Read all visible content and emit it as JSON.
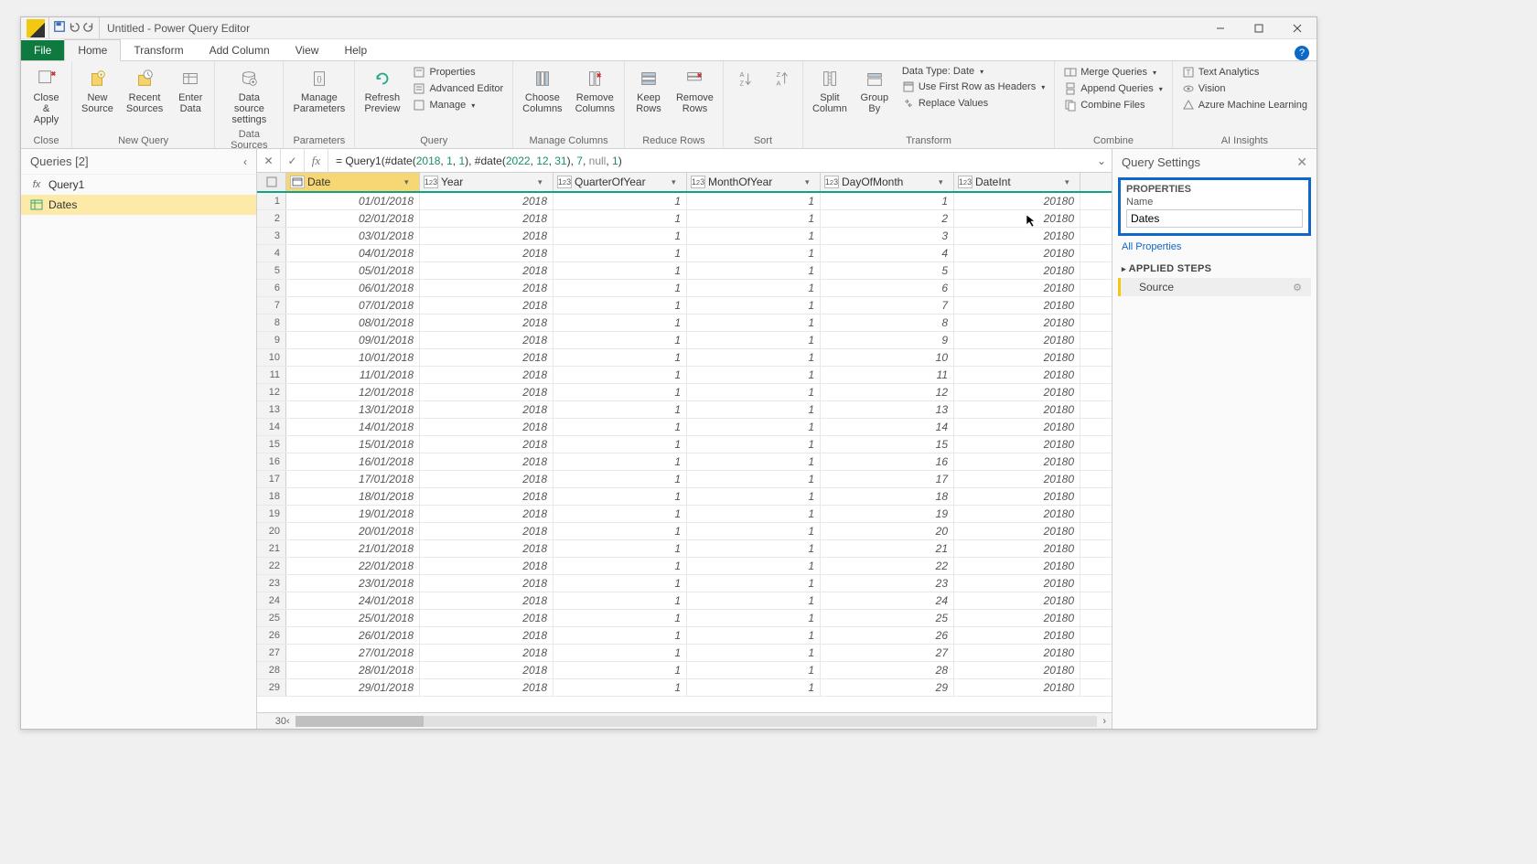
{
  "window": {
    "title": "Untitled - Power Query Editor"
  },
  "tabs": {
    "file": "File",
    "home": "Home",
    "transform": "Transform",
    "addcolumn": "Add Column",
    "view": "View",
    "help": "Help"
  },
  "ribbon": {
    "close": {
      "closeApply": "Close &\nApply",
      "group": "Close"
    },
    "newquery": {
      "newSource": "New\nSource",
      "recentSources": "Recent\nSources",
      "enterData": "Enter\nData",
      "group": "New Query"
    },
    "datasources": {
      "dsSettings": "Data source\nsettings",
      "group": "Data Sources"
    },
    "parameters": {
      "manage": "Manage\nParameters",
      "group": "Parameters"
    },
    "query": {
      "refresh": "Refresh\nPreview",
      "properties": "Properties",
      "advEditor": "Advanced Editor",
      "manage": "Manage",
      "group": "Query"
    },
    "managecols": {
      "choose": "Choose\nColumns",
      "remove": "Remove\nColumns",
      "group": "Manage Columns"
    },
    "reducerows": {
      "keep": "Keep\nRows",
      "removerows": "Remove\nRows",
      "group": "Reduce Rows"
    },
    "sort": {
      "group": "Sort"
    },
    "transform": {
      "split": "Split\nColumn",
      "groupby": "Group\nBy",
      "datatype": "Data Type: Date",
      "firstrow": "Use First Row as Headers",
      "replace": "Replace Values",
      "group": "Transform"
    },
    "combine": {
      "merge": "Merge Queries",
      "append": "Append Queries",
      "combinefiles": "Combine Files",
      "group": "Combine"
    },
    "ai": {
      "textan": "Text Analytics",
      "vision": "Vision",
      "aml": "Azure Machine Learning",
      "group": "AI Insights"
    }
  },
  "queriesPane": {
    "title": "Queries [2]",
    "items": [
      {
        "name": "Query1",
        "type": "fx"
      },
      {
        "name": "Dates",
        "type": "table",
        "selected": true
      }
    ]
  },
  "formula": {
    "prefix": "= Query1(#date(",
    "y1": "2018",
    "c1": ", ",
    "m1": "1",
    "c2": ", ",
    "d1": "1",
    "mid": "), #date(",
    "y2": "2022",
    "c3": ", ",
    "m2": "12",
    "c4": ", ",
    "d2": "31",
    "tail1": "), ",
    "step": "7",
    "tail2": ", ",
    "nul": "null",
    "tail3": ", ",
    "one": "1",
    "tail4": ")"
  },
  "columns": [
    {
      "key": "Date",
      "label": "Date",
      "type": "date",
      "selected": true,
      "width": "cw-date"
    },
    {
      "key": "Year",
      "label": "Year",
      "type": "123",
      "width": "cw-year"
    },
    {
      "key": "QuarterOfYear",
      "label": "QuarterOfYear",
      "type": "123",
      "width": "cw-q"
    },
    {
      "key": "MonthOfYear",
      "label": "MonthOfYear",
      "type": "123",
      "width": "cw-m"
    },
    {
      "key": "DayOfMonth",
      "label": "DayOfMonth",
      "type": "123",
      "width": "cw-d"
    },
    {
      "key": "DateInt",
      "label": "DateInt",
      "type": "123",
      "width": "cw-di"
    }
  ],
  "rows": [
    {
      "n": 1,
      "Date": "01/01/2018",
      "Year": "2018",
      "QuarterOfYear": "1",
      "MonthOfYear": "1",
      "DayOfMonth": "1",
      "DateInt": "20180"
    },
    {
      "n": 2,
      "Date": "02/01/2018",
      "Year": "2018",
      "QuarterOfYear": "1",
      "MonthOfYear": "1",
      "DayOfMonth": "2",
      "DateInt": "20180"
    },
    {
      "n": 3,
      "Date": "03/01/2018",
      "Year": "2018",
      "QuarterOfYear": "1",
      "MonthOfYear": "1",
      "DayOfMonth": "3",
      "DateInt": "20180"
    },
    {
      "n": 4,
      "Date": "04/01/2018",
      "Year": "2018",
      "QuarterOfYear": "1",
      "MonthOfYear": "1",
      "DayOfMonth": "4",
      "DateInt": "20180"
    },
    {
      "n": 5,
      "Date": "05/01/2018",
      "Year": "2018",
      "QuarterOfYear": "1",
      "MonthOfYear": "1",
      "DayOfMonth": "5",
      "DateInt": "20180"
    },
    {
      "n": 6,
      "Date": "06/01/2018",
      "Year": "2018",
      "QuarterOfYear": "1",
      "MonthOfYear": "1",
      "DayOfMonth": "6",
      "DateInt": "20180"
    },
    {
      "n": 7,
      "Date": "07/01/2018",
      "Year": "2018",
      "QuarterOfYear": "1",
      "MonthOfYear": "1",
      "DayOfMonth": "7",
      "DateInt": "20180"
    },
    {
      "n": 8,
      "Date": "08/01/2018",
      "Year": "2018",
      "QuarterOfYear": "1",
      "MonthOfYear": "1",
      "DayOfMonth": "8",
      "DateInt": "20180"
    },
    {
      "n": 9,
      "Date": "09/01/2018",
      "Year": "2018",
      "QuarterOfYear": "1",
      "MonthOfYear": "1",
      "DayOfMonth": "9",
      "DateInt": "20180"
    },
    {
      "n": 10,
      "Date": "10/01/2018",
      "Year": "2018",
      "QuarterOfYear": "1",
      "MonthOfYear": "1",
      "DayOfMonth": "10",
      "DateInt": "20180"
    },
    {
      "n": 11,
      "Date": "11/01/2018",
      "Year": "2018",
      "QuarterOfYear": "1",
      "MonthOfYear": "1",
      "DayOfMonth": "11",
      "DateInt": "20180"
    },
    {
      "n": 12,
      "Date": "12/01/2018",
      "Year": "2018",
      "QuarterOfYear": "1",
      "MonthOfYear": "1",
      "DayOfMonth": "12",
      "DateInt": "20180"
    },
    {
      "n": 13,
      "Date": "13/01/2018",
      "Year": "2018",
      "QuarterOfYear": "1",
      "MonthOfYear": "1",
      "DayOfMonth": "13",
      "DateInt": "20180"
    },
    {
      "n": 14,
      "Date": "14/01/2018",
      "Year": "2018",
      "QuarterOfYear": "1",
      "MonthOfYear": "1",
      "DayOfMonth": "14",
      "DateInt": "20180"
    },
    {
      "n": 15,
      "Date": "15/01/2018",
      "Year": "2018",
      "QuarterOfYear": "1",
      "MonthOfYear": "1",
      "DayOfMonth": "15",
      "DateInt": "20180"
    },
    {
      "n": 16,
      "Date": "16/01/2018",
      "Year": "2018",
      "QuarterOfYear": "1",
      "MonthOfYear": "1",
      "DayOfMonth": "16",
      "DateInt": "20180"
    },
    {
      "n": 17,
      "Date": "17/01/2018",
      "Year": "2018",
      "QuarterOfYear": "1",
      "MonthOfYear": "1",
      "DayOfMonth": "17",
      "DateInt": "20180"
    },
    {
      "n": 18,
      "Date": "18/01/2018",
      "Year": "2018",
      "QuarterOfYear": "1",
      "MonthOfYear": "1",
      "DayOfMonth": "18",
      "DateInt": "20180"
    },
    {
      "n": 19,
      "Date": "19/01/2018",
      "Year": "2018",
      "QuarterOfYear": "1",
      "MonthOfYear": "1",
      "DayOfMonth": "19",
      "DateInt": "20180"
    },
    {
      "n": 20,
      "Date": "20/01/2018",
      "Year": "2018",
      "QuarterOfYear": "1",
      "MonthOfYear": "1",
      "DayOfMonth": "20",
      "DateInt": "20180"
    },
    {
      "n": 21,
      "Date": "21/01/2018",
      "Year": "2018",
      "QuarterOfYear": "1",
      "MonthOfYear": "1",
      "DayOfMonth": "21",
      "DateInt": "20180"
    },
    {
      "n": 22,
      "Date": "22/01/2018",
      "Year": "2018",
      "QuarterOfYear": "1",
      "MonthOfYear": "1",
      "DayOfMonth": "22",
      "DateInt": "20180"
    },
    {
      "n": 23,
      "Date": "23/01/2018",
      "Year": "2018",
      "QuarterOfYear": "1",
      "MonthOfYear": "1",
      "DayOfMonth": "23",
      "DateInt": "20180"
    },
    {
      "n": 24,
      "Date": "24/01/2018",
      "Year": "2018",
      "QuarterOfYear": "1",
      "MonthOfYear": "1",
      "DayOfMonth": "24",
      "DateInt": "20180"
    },
    {
      "n": 25,
      "Date": "25/01/2018",
      "Year": "2018",
      "QuarterOfYear": "1",
      "MonthOfYear": "1",
      "DayOfMonth": "25",
      "DateInt": "20180"
    },
    {
      "n": 26,
      "Date": "26/01/2018",
      "Year": "2018",
      "QuarterOfYear": "1",
      "MonthOfYear": "1",
      "DayOfMonth": "26",
      "DateInt": "20180"
    },
    {
      "n": 27,
      "Date": "27/01/2018",
      "Year": "2018",
      "QuarterOfYear": "1",
      "MonthOfYear": "1",
      "DayOfMonth": "27",
      "DateInt": "20180"
    },
    {
      "n": 28,
      "Date": "28/01/2018",
      "Year": "2018",
      "QuarterOfYear": "1",
      "MonthOfYear": "1",
      "DayOfMonth": "28",
      "DateInt": "20180"
    },
    {
      "n": 29,
      "Date": "29/01/2018",
      "Year": "2018",
      "QuarterOfYear": "1",
      "MonthOfYear": "1",
      "DayOfMonth": "29",
      "DateInt": "20180"
    }
  ],
  "lastRowNum": "30",
  "settings": {
    "title": "Query Settings",
    "properties": "PROPERTIES",
    "nameLabel": "Name",
    "nameValue": "Dates",
    "allProps": "All Properties",
    "appliedSteps": "APPLIED STEPS",
    "steps": [
      {
        "name": "Source"
      }
    ]
  }
}
